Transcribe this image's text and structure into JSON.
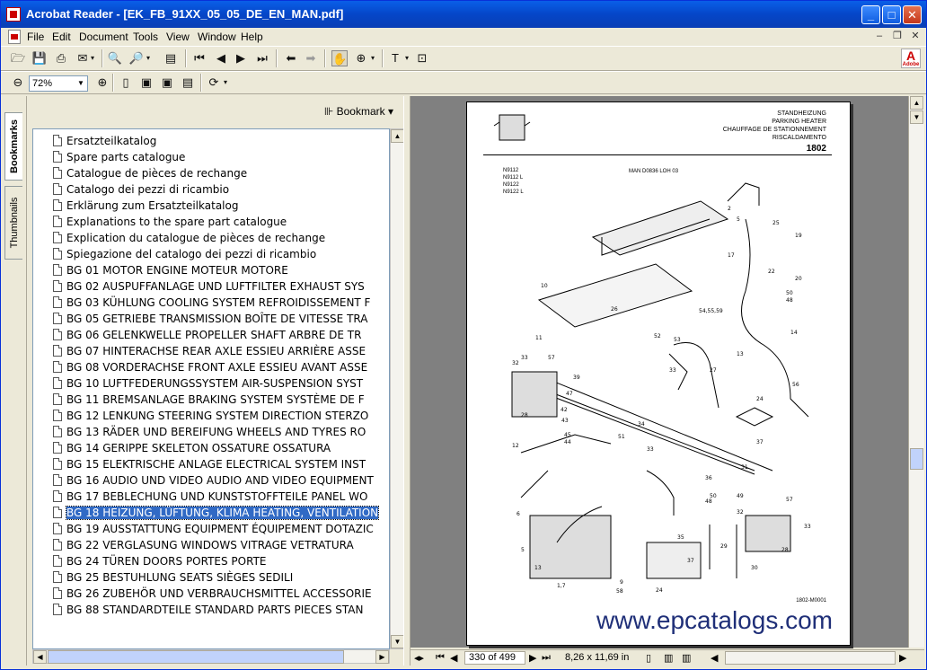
{
  "window": {
    "title": "Acrobat Reader - [EK_FB_91XX_05_05_DE_EN_MAN.pdf]",
    "min": "_",
    "max": "□",
    "close": "✕"
  },
  "menu": [
    "File",
    "Edit",
    "Document",
    "Tools",
    "View",
    "Window",
    "Help"
  ],
  "toolbar": {
    "zoom_value": "72%"
  },
  "nav_tabs": {
    "bookmarks": "Bookmarks",
    "thumbnails": "Thumbnails"
  },
  "bookmark_panel": {
    "menu_label": "Bookmark ▾",
    "items": [
      "Ersatzteilkatalog",
      "Spare parts catalogue",
      "Catalogue de pièces de rechange",
      "Catalogo dei pezzi di ricambio",
      "Erklärung zum Ersatzteilkatalog",
      "Explanations to the spare part catalogue",
      "Explication du catalogue de pièces de rechange",
      "Spiegazione del catalogo dei pezzi di ricambio",
      "BG 01 MOTOR ENGINE MOTEUR MOTORE",
      "BG 02 AUSPUFFANLAGE UND LUFTFILTER EXHAUST SYS",
      "BG 03 KÜHLUNG COOLING SYSTEM REFROIDISSEMENT F",
      "BG 05 GETRIEBE TRANSMISSION BOÎTE DE VITESSE TRA",
      "BG 06 GELENKWELLE PROPELLER SHAFT ARBRE DE TR",
      "BG 07 HINTERACHSE REAR AXLE ESSIEU ARRIÈRE ASSE",
      "BG 08 VORDERACHSE FRONT AXLE ESSIEU AVANT ASSE",
      "BG 10 LUFTFEDERUNGSSYSTEM AIR-SUSPENSION SYST",
      "BG 11 BREMSANLAGE BRAKING SYSTEM SYSTÈME DE F",
      "BG 12 LENKUNG STEERING SYSTEM DIRECTION STERZO",
      "BG 13 RÄDER UND BEREIFUNG WHEELS AND TYRES RO",
      "BG 14 GERIPPE SKELETON OSSATURE OSSATURA",
      "BG 15 ELEKTRISCHE ANLAGE ELECTRICAL SYSTEM INST",
      "BG 16 AUDIO UND VIDEO AUDIO AND VIDEO EQUIPMENT",
      "BG 17 BEBLECHUNG UND KUNSTSTOFFTEILE PANEL WO",
      "BG 18 HEIZUNG, LÜFTUNG, KLIMA HEATING, VENTILATION",
      "BG 19 AUSSTATTUNG EQUIPMENT ÉQUIPEMENT DOTAZIC",
      "BG 22 VERGLASUNG WINDOWS VITRAGE VETRATURA",
      "BG 24 TÜREN DOORS PORTES PORTE",
      "BG 25 BESTUHLUNG SEATS SIÈGES SEDILI",
      "BG 26 ZUBEHÖR UND VERBRAUCHSMITTEL ACCESSORIE",
      "BG 88 STANDARDTEILE STANDARD PARTS PIECES STAN"
    ],
    "selected_index": 23
  },
  "page": {
    "header_lines": [
      "STANDHEIZUNG",
      "PARKING HEATER",
      "CHAUFFAGE DE STATIONNEMENT",
      "RISCALDAMENTO"
    ],
    "page_number": "1802",
    "variants": [
      "N9112",
      "N9112    L",
      "N9122",
      "N9122    L"
    ],
    "model": "MAN D0836 LOH 03",
    "diagram_id": "1802-M0001",
    "watermark": "www.epcatalogs.com"
  },
  "status": {
    "page_field": "330 of 499",
    "page_size": "8,26 x 11,69 in"
  }
}
